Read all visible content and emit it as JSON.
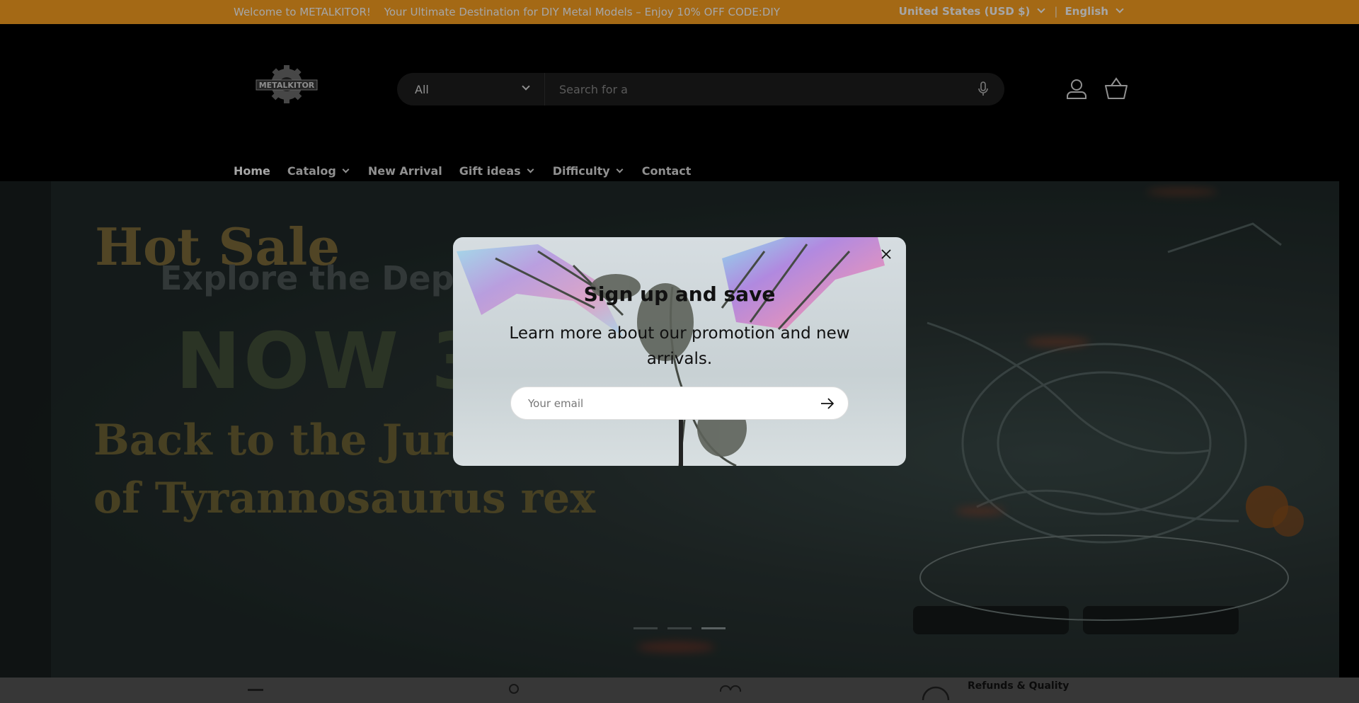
{
  "announcement": {
    "welcome": "Welcome to METALKITOR!",
    "promo": "Your Ultimate Destination for DIY Metal Models – Enjoy 10% OFF CODE:DIY",
    "currency": "United States (USD $)",
    "separator": "|",
    "language": "English",
    "background": "#fca221"
  },
  "header": {
    "logo_text": "METALKITOR",
    "search": {
      "category": "All",
      "placeholder": "Search for a"
    }
  },
  "nav": {
    "items": [
      {
        "label": "Home",
        "active": true
      },
      {
        "label": "Catalog",
        "dropdown": true
      },
      {
        "label": "New Arrival"
      },
      {
        "label": "Gift ideas",
        "dropdown": true
      },
      {
        "label": "Difficulty",
        "dropdown": true
      },
      {
        "label": "Contact"
      }
    ]
  },
  "hero": {
    "line1": "Hot Sale",
    "line2": "Explore the Depth",
    "line3": "NOW 3(",
    "line4a": "Back to the Juras",
    "line4b": "of Tyrannosaurus rex",
    "slides": 3,
    "active_slide": 3
  },
  "features": {
    "item4": "Refunds & Quality"
  },
  "popup": {
    "title": "Sign up and save",
    "subtitle": "Learn more about our promotion and new arrivals.",
    "email_placeholder": "Your email"
  }
}
